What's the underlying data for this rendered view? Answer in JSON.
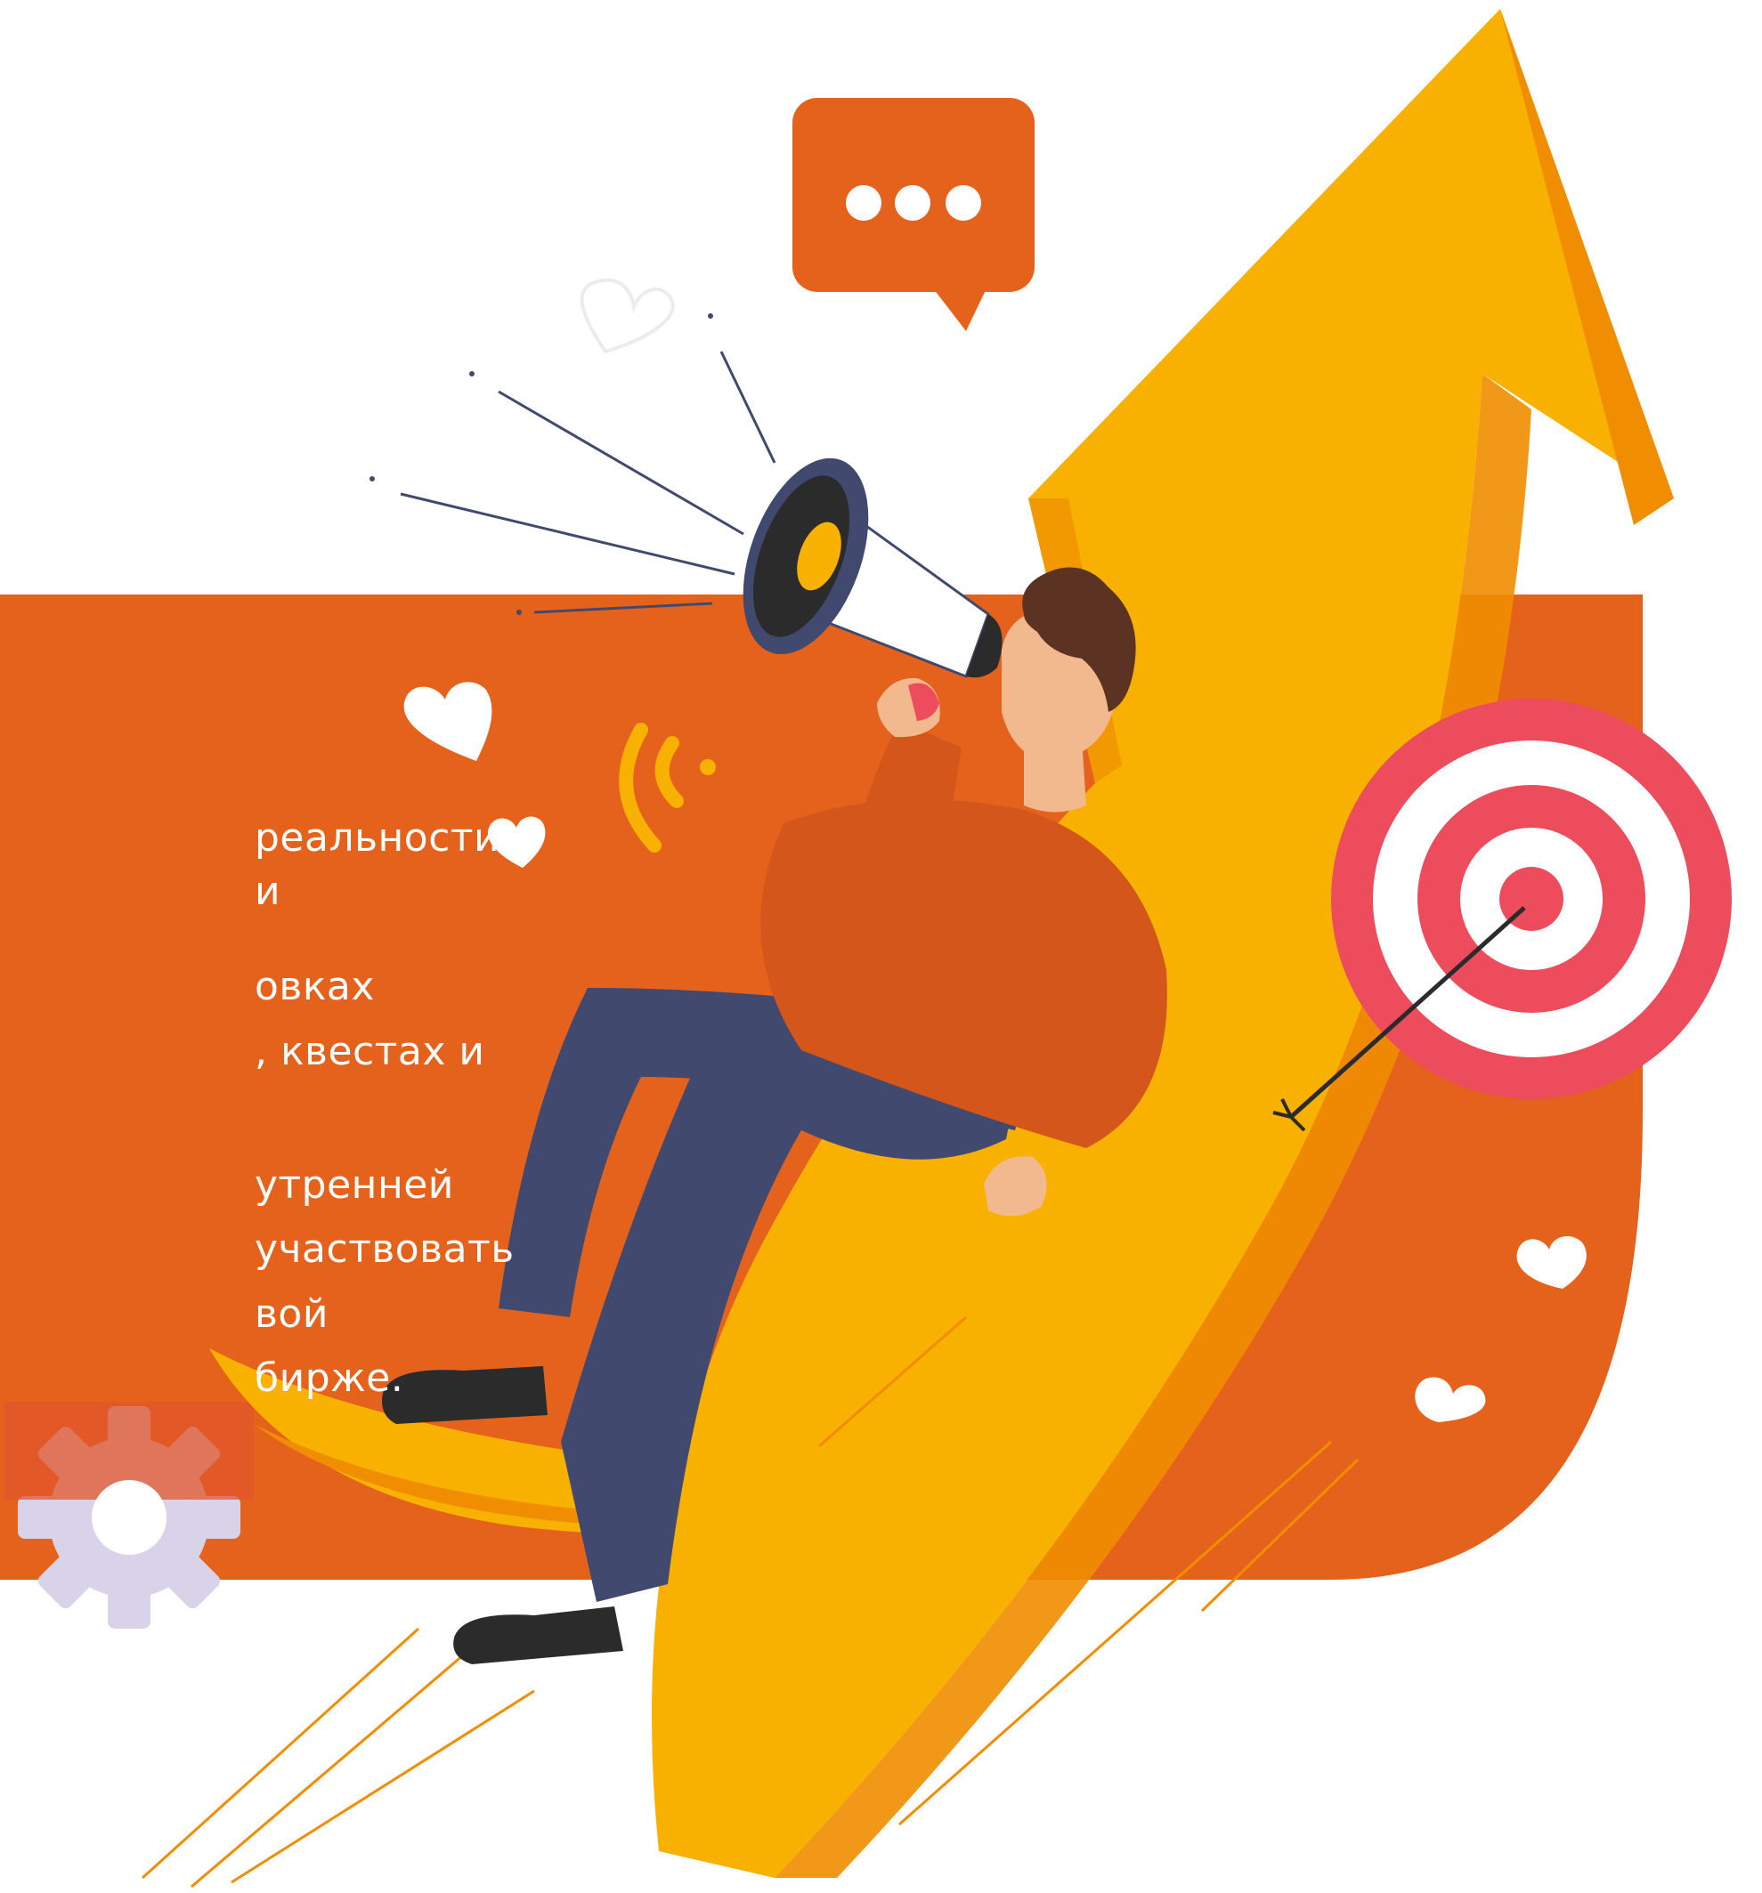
{
  "text": {
    "lines": [
      "реальности.",
      "и",
      "овках",
      ", квестах и",
      "утренней",
      "участвовать",
      "вой",
      "бирже."
    ]
  },
  "colors": {
    "band": "#e5621d",
    "arrow": "#f9b100",
    "arrow_shadow": "#f08d00",
    "bubble": "#e5621d",
    "sweater": "#d4561b",
    "pants": "#414a6e",
    "skin": "#f3b98e",
    "hair": "#5c3322",
    "target_red": "#ec4c5b",
    "gear_purple": "#d9d3ea",
    "gear_orange": "#e0562a"
  },
  "icons": [
    "speech-bubble-icon",
    "megaphone-icon",
    "target-icon",
    "arrow-up-icon",
    "heart-icon",
    "signal-icon",
    "gear-icon"
  ]
}
